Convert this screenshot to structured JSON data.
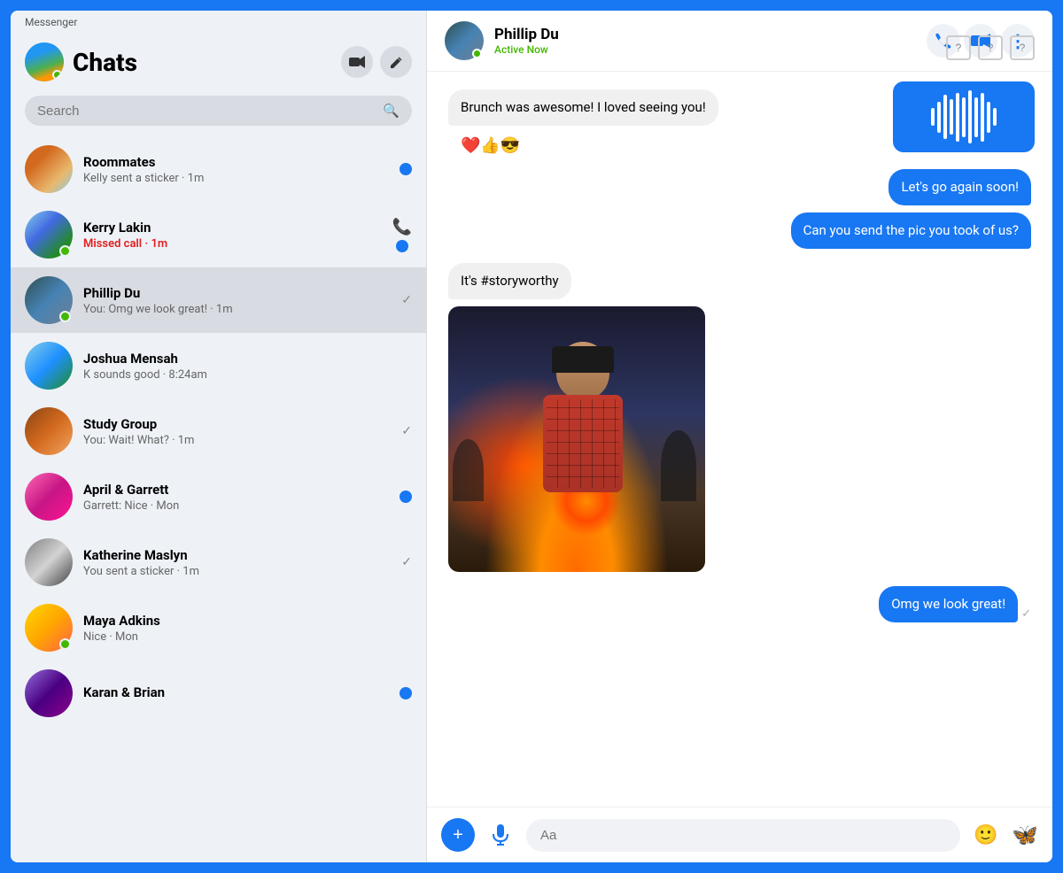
{
  "app": {
    "title": "Messenger"
  },
  "sidebar": {
    "title": "Chats",
    "search_placeholder": "Search",
    "video_btn": "📹",
    "compose_btn": "✏️",
    "chats": [
      {
        "id": "roommates",
        "name": "Roommates",
        "preview": "Kelly sent a sticker · 1m",
        "avatar_class": "av-roommates",
        "has_online": false,
        "unread": true,
        "status": "unread-dot"
      },
      {
        "id": "kerry",
        "name": "Kerry Lakin",
        "preview": "Missed call · 1m",
        "preview_class": "missed-call",
        "avatar_class": "av-kerry",
        "has_online": true,
        "unread": true,
        "status": "phone-unread"
      },
      {
        "id": "phillip",
        "name": "Phillip Du",
        "preview": "You: Omg we look great! · 1m",
        "avatar_class": "av-phillip",
        "has_online": true,
        "unread": false,
        "status": "read-check",
        "active": true
      },
      {
        "id": "joshua",
        "name": "Joshua Mensah",
        "preview": "K sounds good · 8:24am",
        "avatar_class": "av-joshua",
        "has_online": false,
        "unread": false,
        "status": "none"
      },
      {
        "id": "study",
        "name": "Study Group",
        "preview": "You: Wait! What? · 1m",
        "avatar_class": "av-study",
        "has_online": false,
        "unread": false,
        "status": "read-check"
      },
      {
        "id": "april",
        "name": "April & Garrett",
        "preview": "Garrett: Nice · Mon",
        "avatar_class": "av-april",
        "has_online": false,
        "unread": true,
        "status": "unread-dot"
      },
      {
        "id": "katherine",
        "name": "Katherine Maslyn",
        "preview": "You sent a sticker · 1m",
        "avatar_class": "av-katherine",
        "has_online": false,
        "unread": false,
        "status": "read-check"
      },
      {
        "id": "maya",
        "name": "Maya Adkins",
        "preview": "Nice · Mon",
        "avatar_class": "av-maya",
        "has_online": true,
        "unread": false,
        "status": "none"
      },
      {
        "id": "karan",
        "name": "Karan & Brian",
        "preview": "",
        "avatar_class": "av-karan",
        "has_online": false,
        "unread": true,
        "status": "unread-dot"
      }
    ]
  },
  "chat": {
    "user": {
      "name": "Phillip Du",
      "status": "Active Now"
    },
    "messages": [
      {
        "id": "msg1",
        "type": "received",
        "text": "Brunch was awesome! I loved seeing you!",
        "reactions": "❤️👍😎"
      },
      {
        "id": "msg2",
        "type": "sent",
        "text": "Let's go again soon!"
      },
      {
        "id": "msg3",
        "type": "sent",
        "text": "Can you send the pic you took of us?"
      },
      {
        "id": "msg4",
        "type": "received",
        "text": "It's #storyworthy"
      },
      {
        "id": "msg5",
        "type": "received",
        "is_image": true
      },
      {
        "id": "msg6",
        "type": "sent",
        "text": "Omg we look great!",
        "has_check": true
      }
    ],
    "input_placeholder": "Aa"
  },
  "top_icons": [
    "?",
    "?",
    "?"
  ],
  "header_actions": {
    "phone": "📞",
    "video": "📹",
    "more": "⋮"
  }
}
